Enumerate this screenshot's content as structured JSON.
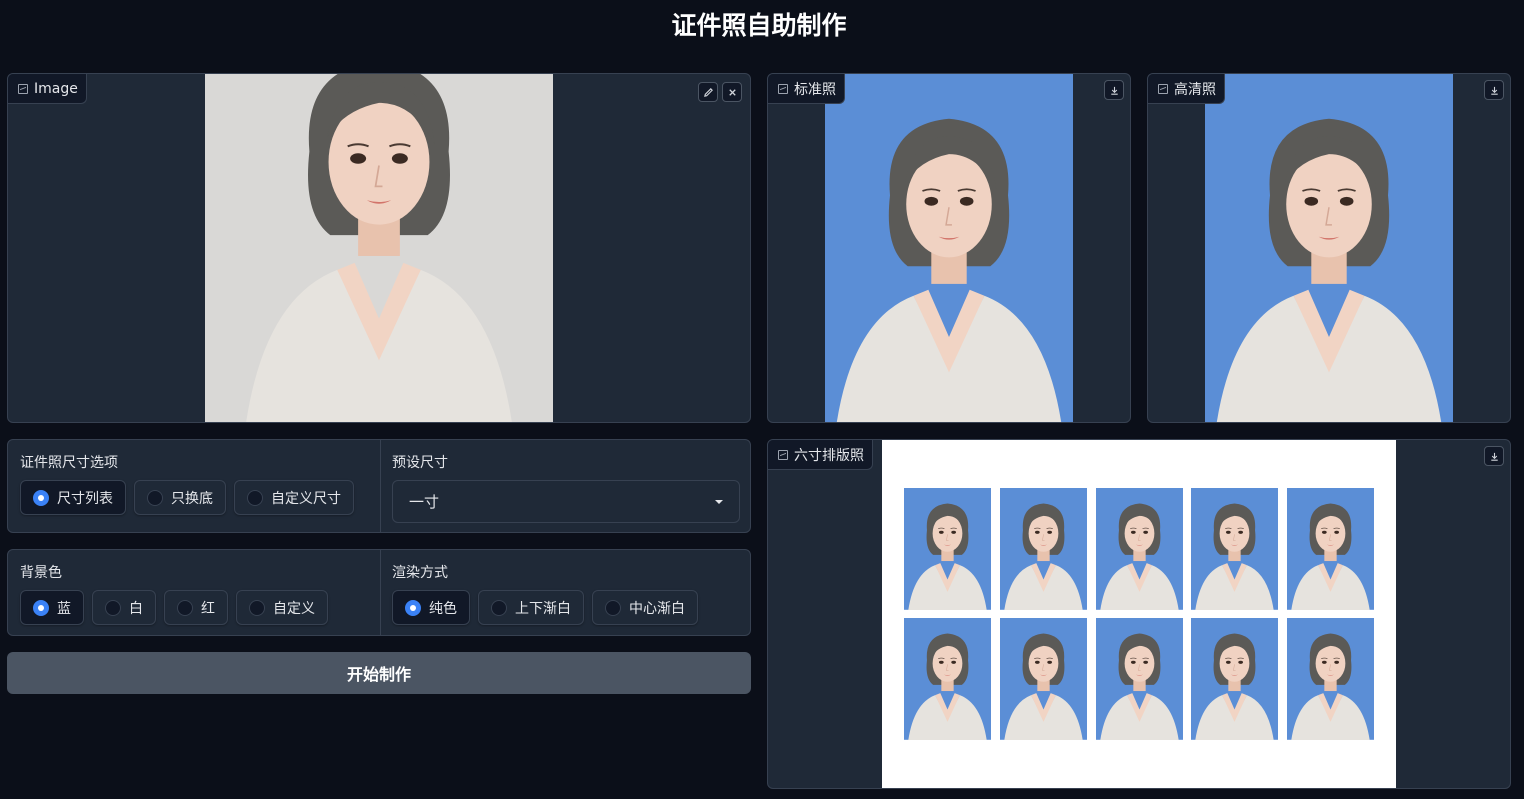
{
  "page": {
    "title": "证件照自助制作"
  },
  "input_panel": {
    "label": "Image",
    "edit_icon": "pencil-icon",
    "clear_icon": "close-icon",
    "bg_color": "#d9d8d6"
  },
  "standard_panel": {
    "label": "标准照",
    "download_icon": "download-icon"
  },
  "hd_panel": {
    "label": "高清照",
    "download_icon": "download-icon"
  },
  "layout_panel": {
    "label": "六寸排版照",
    "download_icon": "download-icon",
    "rows": 2,
    "cols": 5
  },
  "size_options": {
    "label": "证件照尺寸选项",
    "options": [
      "尺寸列表",
      "只换底",
      "自定义尺寸"
    ],
    "selected": "尺寸列表"
  },
  "preset_size": {
    "label": "预设尺寸",
    "value": "一寸"
  },
  "background": {
    "label": "背景色",
    "options": [
      "蓝",
      "白",
      "红",
      "自定义"
    ],
    "selected": "蓝",
    "blue_hex": "#5b8ed6"
  },
  "render_mode": {
    "label": "渲染方式",
    "options": [
      "纯色",
      "上下渐白",
      "中心渐白"
    ],
    "selected": "纯色"
  },
  "start_button": {
    "label": "开始制作"
  }
}
